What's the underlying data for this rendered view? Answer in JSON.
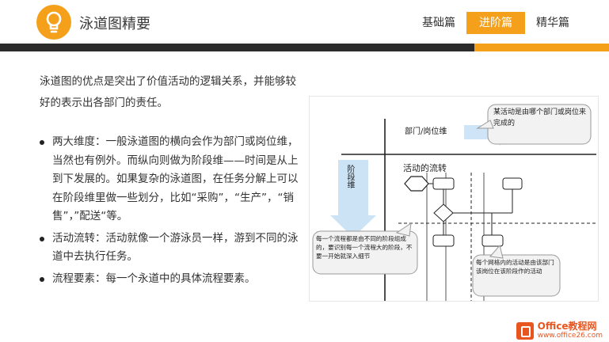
{
  "header": {
    "title": "泳道图精要",
    "tabs": [
      {
        "label": "基础篇",
        "active": false
      },
      {
        "label": "进阶篇",
        "active": true
      },
      {
        "label": "精华篇",
        "active": false
      }
    ]
  },
  "content": {
    "intro": "泳道图的优点是突出了价值活动的逻辑关系，并能够较好的表示出各部门的责任。",
    "bullets": [
      "两大维度：一般泳道图的横向会作为部门或岗位维，当然也有例外。而纵向则做为阶段维——时间是从上到下发展的。如果复杂的泳道图，在任务分解上可以在阶段维里做一些划分，比如“采购”，“生产”，“销售”，”配送“等。",
      "活动流转：活动就像一个游泳员一样，游到不同的泳道中去执行任务。",
      "流程要素：每一个永道中的具体流程要素。"
    ]
  },
  "diagram": {
    "dept_label": "部门/岗位维",
    "callout_top": "某活动是由哪个部门或岗位来完成的",
    "stage_label": "阶段维",
    "flow_label": "活动的流转",
    "callout_left": "每一个流程都是由不同的阶段组成的，要识别每一个流程大的阶段，不要一开始就深入细节",
    "callout_right": "每个网格内的活动是由该部门该岗位在该阶段作的活动"
  },
  "watermark": {
    "main": "Office教程网",
    "sub": "www.office26.com"
  },
  "colors": {
    "accent": "#f5a01a",
    "bar": "#2b2b2b",
    "arrow": "#c7dff4"
  }
}
